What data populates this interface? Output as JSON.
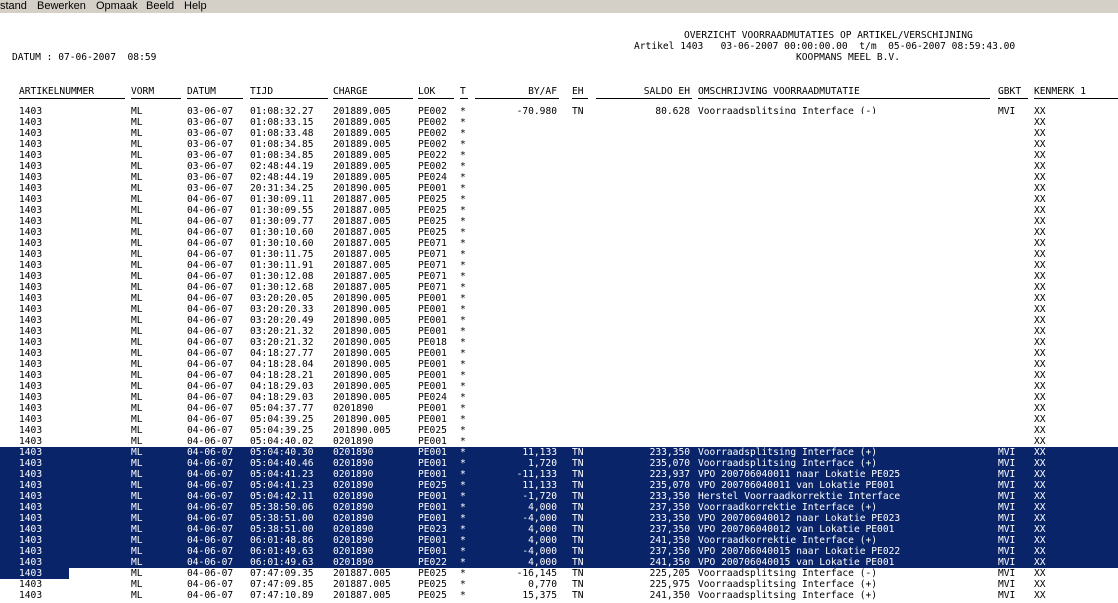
{
  "menu": [
    "stand",
    "Bewerken",
    "Opmaak",
    "Beeld",
    "Help"
  ],
  "report": {
    "title": "OVERZICHT VOORRAADMUTATIES OP ARTIKEL/VERSCHIJNING",
    "subtitle": "Artikel 1403   03-06-2007 00:00:00.00  t/m  05-06-2007 08:59:43.00",
    "company": "KOOPMANS MEEL B.V.",
    "datum": "DATUM : 07-06-2007  08:59"
  },
  "columns": [
    "ARTIKELNUMMER",
    "VORM",
    "DATUM",
    "TIJD",
    "CHARGE",
    "LOK",
    "T",
    "BY/AF",
    "EH",
    "SALDO EH",
    "OMSCHRIJVING VOORRAADMUTATIE",
    "GBKT",
    "KENMERK 1"
  ],
  "rows": [
    {
      "art": "1403",
      "vorm": "ML",
      "datum": "03-06-07",
      "tijd": "01:08:32.27",
      "charge": "201889.005",
      "lok": "PE002",
      "t": "*",
      "byaf": "-70,980",
      "eh": "TN",
      "saldo": "80,628",
      "oms": "Voorraadsplitsing Interface (-)",
      "gbkt": "MVI",
      "ken": "XX"
    },
    {
      "art": "1403",
      "vorm": "ML",
      "datum": "03-06-07",
      "tijd": "01:08:33.15",
      "charge": "201889.005",
      "lok": "PE002",
      "t": "*",
      "byaf": "",
      "eh": "",
      "saldo": "",
      "oms": "",
      "gbkt": "",
      "ken": "XX"
    },
    {
      "art": "1403",
      "vorm": "ML",
      "datum": "03-06-07",
      "tijd": "01:08:33.48",
      "charge": "201889.005",
      "lok": "PE002",
      "t": "*",
      "byaf": "",
      "eh": "",
      "saldo": "",
      "oms": "",
      "gbkt": "",
      "ken": "XX"
    },
    {
      "art": "1403",
      "vorm": "ML",
      "datum": "03-06-07",
      "tijd": "01:08:34.85",
      "charge": "201889.005",
      "lok": "PE002",
      "t": "*",
      "byaf": "",
      "eh": "",
      "saldo": "",
      "oms": "",
      "gbkt": "",
      "ken": "XX"
    },
    {
      "art": "1403",
      "vorm": "ML",
      "datum": "03-06-07",
      "tijd": "01:08:34.85",
      "charge": "201889.005",
      "lok": "PE022",
      "t": "*",
      "byaf": "",
      "eh": "",
      "saldo": "",
      "oms": "",
      "gbkt": "",
      "ken": "XX"
    },
    {
      "art": "1403",
      "vorm": "ML",
      "datum": "03-06-07",
      "tijd": "02:48:44.19",
      "charge": "201889.005",
      "lok": "PE002",
      "t": "*",
      "byaf": "",
      "eh": "",
      "saldo": "",
      "oms": "",
      "gbkt": "",
      "ken": "XX"
    },
    {
      "art": "1403",
      "vorm": "ML",
      "datum": "03-06-07",
      "tijd": "02:48:44.19",
      "charge": "201889.005",
      "lok": "PE024",
      "t": "*",
      "byaf": "",
      "eh": "",
      "saldo": "",
      "oms": "",
      "gbkt": "",
      "ken": "XX"
    },
    {
      "art": "1403",
      "vorm": "ML",
      "datum": "03-06-07",
      "tijd": "20:31:34.25",
      "charge": "201890.005",
      "lok": "PE001",
      "t": "*",
      "byaf": "",
      "eh": "",
      "saldo": "",
      "oms": "",
      "gbkt": "",
      "ken": "XX"
    },
    {
      "art": "1403",
      "vorm": "ML",
      "datum": "04-06-07",
      "tijd": "01:30:09.11",
      "charge": "201887.005",
      "lok": "PE025",
      "t": "*",
      "byaf": "",
      "eh": "",
      "saldo": "",
      "oms": "",
      "gbkt": "",
      "ken": "XX"
    },
    {
      "art": "1403",
      "vorm": "ML",
      "datum": "04-06-07",
      "tijd": "01:30:09.55",
      "charge": "201887.005",
      "lok": "PE025",
      "t": "*",
      "byaf": "",
      "eh": "",
      "saldo": "",
      "oms": "",
      "gbkt": "",
      "ken": "XX"
    },
    {
      "art": "1403",
      "vorm": "ML",
      "datum": "04-06-07",
      "tijd": "01:30:09.77",
      "charge": "201887.005",
      "lok": "PE025",
      "t": "*",
      "byaf": "",
      "eh": "",
      "saldo": "",
      "oms": "",
      "gbkt": "",
      "ken": "XX"
    },
    {
      "art": "1403",
      "vorm": "ML",
      "datum": "04-06-07",
      "tijd": "01:30:10.60",
      "charge": "201887.005",
      "lok": "PE025",
      "t": "*",
      "byaf": "",
      "eh": "",
      "saldo": "",
      "oms": "",
      "gbkt": "",
      "ken": "XX"
    },
    {
      "art": "1403",
      "vorm": "ML",
      "datum": "04-06-07",
      "tijd": "01:30:10.60",
      "charge": "201887.005",
      "lok": "PE071",
      "t": "*",
      "byaf": "",
      "eh": "",
      "saldo": "",
      "oms": "",
      "gbkt": "",
      "ken": "XX"
    },
    {
      "art": "1403",
      "vorm": "ML",
      "datum": "04-06-07",
      "tijd": "01:30:11.75",
      "charge": "201887.005",
      "lok": "PE071",
      "t": "*",
      "byaf": "",
      "eh": "",
      "saldo": "",
      "oms": "",
      "gbkt": "",
      "ken": "XX"
    },
    {
      "art": "1403",
      "vorm": "ML",
      "datum": "04-06-07",
      "tijd": "01:30:11.91",
      "charge": "201887.005",
      "lok": "PE071",
      "t": "*",
      "byaf": "",
      "eh": "",
      "saldo": "",
      "oms": "",
      "gbkt": "",
      "ken": "XX"
    },
    {
      "art": "1403",
      "vorm": "ML",
      "datum": "04-06-07",
      "tijd": "01:30:12.08",
      "charge": "201887.005",
      "lok": "PE071",
      "t": "*",
      "byaf": "",
      "eh": "",
      "saldo": "",
      "oms": "",
      "gbkt": "",
      "ken": "XX"
    },
    {
      "art": "1403",
      "vorm": "ML",
      "datum": "04-06-07",
      "tijd": "01:30:12.68",
      "charge": "201887.005",
      "lok": "PE071",
      "t": "*",
      "byaf": "",
      "eh": "",
      "saldo": "",
      "oms": "",
      "gbkt": "",
      "ken": "XX"
    },
    {
      "art": "1403",
      "vorm": "ML",
      "datum": "04-06-07",
      "tijd": "03:20:20.05",
      "charge": "201890.005",
      "lok": "PE001",
      "t": "*",
      "byaf": "",
      "eh": "",
      "saldo": "",
      "oms": "",
      "gbkt": "",
      "ken": "XX"
    },
    {
      "art": "1403",
      "vorm": "ML",
      "datum": "04-06-07",
      "tijd": "03:20:20.33",
      "charge": "201890.005",
      "lok": "PE001",
      "t": "*",
      "byaf": "",
      "eh": "",
      "saldo": "",
      "oms": "",
      "gbkt": "",
      "ken": "XX"
    },
    {
      "art": "1403",
      "vorm": "ML",
      "datum": "04-06-07",
      "tijd": "03:20:20.49",
      "charge": "201890.005",
      "lok": "PE001",
      "t": "*",
      "byaf": "",
      "eh": "",
      "saldo": "",
      "oms": "",
      "gbkt": "",
      "ken": "XX"
    },
    {
      "art": "1403",
      "vorm": "ML",
      "datum": "04-06-07",
      "tijd": "03:20:21.32",
      "charge": "201890.005",
      "lok": "PE001",
      "t": "*",
      "byaf": "",
      "eh": "",
      "saldo": "",
      "oms": "",
      "gbkt": "",
      "ken": "XX"
    },
    {
      "art": "1403",
      "vorm": "ML",
      "datum": "04-06-07",
      "tijd": "03:20:21.32",
      "charge": "201890.005",
      "lok": "PE018",
      "t": "*",
      "byaf": "",
      "eh": "",
      "saldo": "",
      "oms": "",
      "gbkt": "",
      "ken": "XX"
    },
    {
      "art": "1403",
      "vorm": "ML",
      "datum": "04-06-07",
      "tijd": "04:18:27.77",
      "charge": "201890.005",
      "lok": "PE001",
      "t": "*",
      "byaf": "",
      "eh": "",
      "saldo": "",
      "oms": "",
      "gbkt": "",
      "ken": "XX"
    },
    {
      "art": "1403",
      "vorm": "ML",
      "datum": "04-06-07",
      "tijd": "04:18:28.04",
      "charge": "201890.005",
      "lok": "PE001",
      "t": "*",
      "byaf": "",
      "eh": "",
      "saldo": "",
      "oms": "",
      "gbkt": "",
      "ken": "XX"
    },
    {
      "art": "1403",
      "vorm": "ML",
      "datum": "04-06-07",
      "tijd": "04:18:28.21",
      "charge": "201890.005",
      "lok": "PE001",
      "t": "*",
      "byaf": "",
      "eh": "",
      "saldo": "",
      "oms": "",
      "gbkt": "",
      "ken": "XX"
    },
    {
      "art": "1403",
      "vorm": "ML",
      "datum": "04-06-07",
      "tijd": "04:18:29.03",
      "charge": "201890.005",
      "lok": "PE001",
      "t": "*",
      "byaf": "",
      "eh": "",
      "saldo": "",
      "oms": "",
      "gbkt": "",
      "ken": "XX"
    },
    {
      "art": "1403",
      "vorm": "ML",
      "datum": "04-06-07",
      "tijd": "04:18:29.03",
      "charge": "201890.005",
      "lok": "PE024",
      "t": "*",
      "byaf": "",
      "eh": "",
      "saldo": "",
      "oms": "",
      "gbkt": "",
      "ken": "XX"
    },
    {
      "art": "1403",
      "vorm": "ML",
      "datum": "04-06-07",
      "tijd": "05:04:37.77",
      "charge": "0201890",
      "lok": "PE001",
      "t": "*",
      "byaf": "",
      "eh": "",
      "saldo": "",
      "oms": "",
      "gbkt": "",
      "ken": "XX"
    },
    {
      "art": "1403",
      "vorm": "ML",
      "datum": "04-06-07",
      "tijd": "05:04:39.25",
      "charge": "201890.005",
      "lok": "PE001",
      "t": "*",
      "byaf": "",
      "eh": "",
      "saldo": "",
      "oms": "",
      "gbkt": "",
      "ken": "XX"
    },
    {
      "art": "1403",
      "vorm": "ML",
      "datum": "04-06-07",
      "tijd": "05:04:39.25",
      "charge": "201890.005",
      "lok": "PE025",
      "t": "*",
      "byaf": "",
      "eh": "",
      "saldo": "",
      "oms": "",
      "gbkt": "",
      "ken": "XX"
    },
    {
      "art": "1403",
      "vorm": "ML",
      "datum": "04-06-07",
      "tijd": "05:04:40.02",
      "charge": "0201890",
      "lok": "PE001",
      "t": "*",
      "byaf": "",
      "eh": "",
      "saldo": "",
      "oms": "",
      "gbkt": "",
      "ken": "XX"
    },
    {
      "art": "1403",
      "vorm": "ML",
      "datum": "04-06-07",
      "tijd": "05:04:40.30",
      "charge": "0201890",
      "lok": "PE001",
      "t": "*",
      "byaf": "11,133",
      "eh": "TN",
      "saldo": "233,350",
      "oms": "Voorraadsplitsing Interface (+)",
      "gbkt": "MVI",
      "ken": "XX"
    },
    {
      "art": "1403",
      "vorm": "ML",
      "datum": "04-06-07",
      "tijd": "05:04:40.46",
      "charge": "0201890",
      "lok": "PE001",
      "t": "*",
      "byaf": "1,720",
      "eh": "TN",
      "saldo": "235,070",
      "oms": "Voorraadsplitsing Interface (+)",
      "gbkt": "MVI",
      "ken": "XX"
    },
    {
      "art": "1403",
      "vorm": "ML",
      "datum": "04-06-07",
      "tijd": "05:04:41.23",
      "charge": "0201890",
      "lok": "PE001",
      "t": "*",
      "byaf": "-11,133",
      "eh": "TN",
      "saldo": "223,937",
      "oms": "VPO 200706040011 naar Lokatie PE025",
      "gbkt": "MVI",
      "ken": "XX"
    },
    {
      "art": "1403",
      "vorm": "ML",
      "datum": "04-06-07",
      "tijd": "05:04:41.23",
      "charge": "0201890",
      "lok": "PE025",
      "t": "*",
      "byaf": "11,133",
      "eh": "TN",
      "saldo": "235,070",
      "oms": "VPO 200706040011 van Lokatie PE001",
      "gbkt": "MVI",
      "ken": "XX"
    },
    {
      "art": "1403",
      "vorm": "ML",
      "datum": "04-06-07",
      "tijd": "05:04:42.11",
      "charge": "0201890",
      "lok": "PE001",
      "t": "*",
      "byaf": "-1,720",
      "eh": "TN",
      "saldo": "233,350",
      "oms": "Herstel Voorraadkorrektie Interface",
      "gbkt": "MVI",
      "ken": "XX"
    },
    {
      "art": "1403",
      "vorm": "ML",
      "datum": "04-06-07",
      "tijd": "05:38:50.06",
      "charge": "0201890",
      "lok": "PE001",
      "t": "*",
      "byaf": "4,000",
      "eh": "TN",
      "saldo": "237,350",
      "oms": "Voorraadkorrektie Interface (+)",
      "gbkt": "MVI",
      "ken": "XX"
    },
    {
      "art": "1403",
      "vorm": "ML",
      "datum": "04-06-07",
      "tijd": "05:38:51.00",
      "charge": "0201890",
      "lok": "PE001",
      "t": "*",
      "byaf": "-4,000",
      "eh": "TN",
      "saldo": "233,350",
      "oms": "VPO 200706040012 naar Lokatie PE023",
      "gbkt": "MVI",
      "ken": "XX"
    },
    {
      "art": "1403",
      "vorm": "ML",
      "datum": "04-06-07",
      "tijd": "05:38:51.00",
      "charge": "0201890",
      "lok": "PE023",
      "t": "*",
      "byaf": "4,000",
      "eh": "TN",
      "saldo": "237,350",
      "oms": "VPO 200706040012 van Lokatie PE001",
      "gbkt": "MVI",
      "ken": "XX"
    },
    {
      "art": "1403",
      "vorm": "ML",
      "datum": "04-06-07",
      "tijd": "06:01:48.86",
      "charge": "0201890",
      "lok": "PE001",
      "t": "*",
      "byaf": "4,000",
      "eh": "TN",
      "saldo": "241,350",
      "oms": "Voorraadkorrektie Interface (+)",
      "gbkt": "MVI",
      "ken": "XX"
    },
    {
      "art": "1403",
      "vorm": "ML",
      "datum": "04-06-07",
      "tijd": "06:01:49.63",
      "charge": "0201890",
      "lok": "PE001",
      "t": "*",
      "byaf": "-4,000",
      "eh": "TN",
      "saldo": "237,350",
      "oms": "VPO 200706040015 naar Lokatie PE022",
      "gbkt": "MVI",
      "ken": "XX"
    },
    {
      "art": "1403",
      "vorm": "ML",
      "datum": "04-06-07",
      "tijd": "06:01:49.63",
      "charge": "0201890",
      "lok": "PE022",
      "t": "*",
      "byaf": "4,000",
      "eh": "TN",
      "saldo": "241,350",
      "oms": "VPO 200706040015 van Lokatie PE001",
      "gbkt": "MVI",
      "ken": "XX"
    },
    {
      "art": "1403",
      "vorm": "ML",
      "datum": "04-06-07",
      "tijd": "07:47:09.35",
      "charge": "201887.005",
      "lok": "PE025",
      "t": "*",
      "byaf": "-16,145",
      "eh": "TN",
      "saldo": "225,205",
      "oms": "Voorraadsplitsing Interface (-)",
      "gbkt": "MVI",
      "ken": "XX"
    },
    {
      "art": "1403",
      "vorm": "ML",
      "datum": "04-06-07",
      "tijd": "07:47:09.85",
      "charge": "201887.005",
      "lok": "PE025",
      "t": "*",
      "byaf": "0,770",
      "eh": "TN",
      "saldo": "225,975",
      "oms": "Voorraadsplitsing Interface (+)",
      "gbkt": "MVI",
      "ken": "XX"
    },
    {
      "art": "1403",
      "vorm": "ML",
      "datum": "04-06-07",
      "tijd": "07:47:10.89",
      "charge": "201887.005",
      "lok": "PE025",
      "t": "*",
      "byaf": "15,375",
      "eh": "TN",
      "saldo": "241,350",
      "oms": "Voorraadsplitsing Interface (+)",
      "gbkt": "MVI",
      "ken": "XX"
    }
  ],
  "selection": {
    "first_full": 31,
    "last_full": 41,
    "partial": 42,
    "highlight_color": "#0a246a"
  }
}
